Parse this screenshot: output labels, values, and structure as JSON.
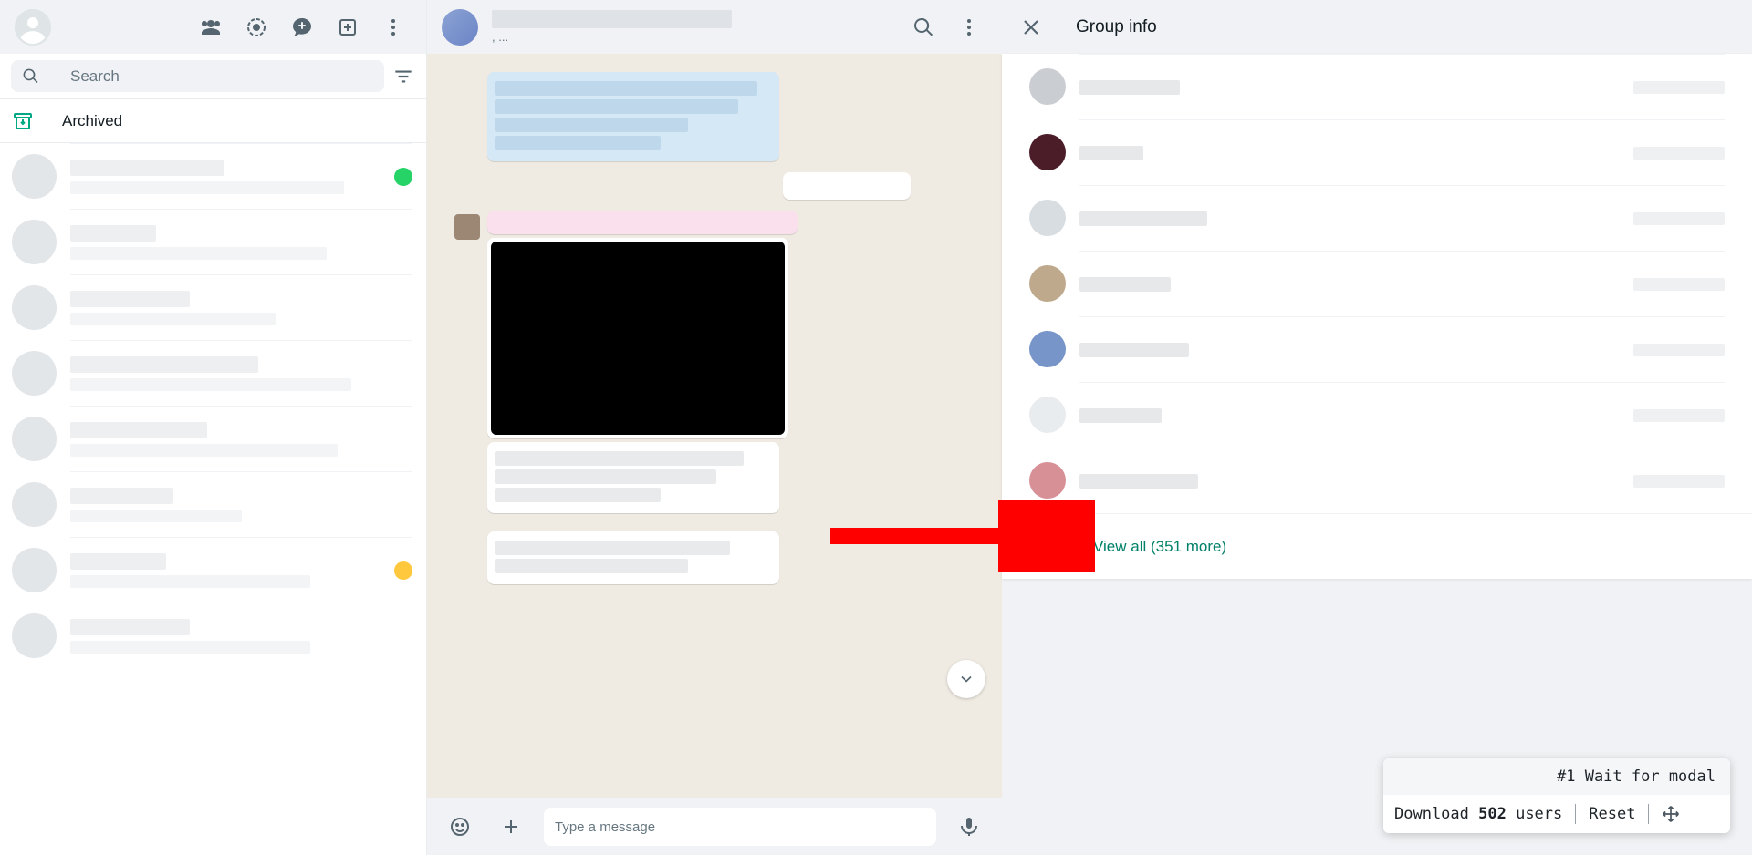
{
  "sidebar": {
    "search_placeholder": "Search",
    "archived_label": "Archived"
  },
  "chat": {
    "subtitle_suffix": ", ...",
    "composer_placeholder": "Type a message"
  },
  "info": {
    "title": "Group info",
    "view_all_label": "View all (351 more)"
  },
  "ext": {
    "status_text": "#1 Wait for modal",
    "download_prefix": "Download ",
    "download_count": "502",
    "download_suffix": " users",
    "reset_label": "Reset"
  }
}
